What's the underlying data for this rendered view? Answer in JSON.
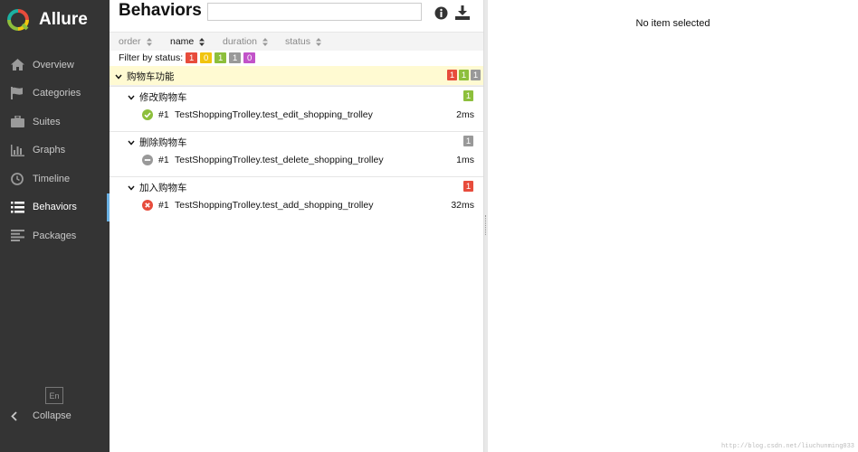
{
  "brand": {
    "name": "Allure"
  },
  "nav": [
    {
      "label": "Overview",
      "icon": "home-icon"
    },
    {
      "label": "Categories",
      "icon": "flag-icon"
    },
    {
      "label": "Suites",
      "icon": "briefcase-icon"
    },
    {
      "label": "Graphs",
      "icon": "bar-chart-icon"
    },
    {
      "label": "Timeline",
      "icon": "clock-icon"
    },
    {
      "label": "Behaviors",
      "icon": "list-icon",
      "active": true
    },
    {
      "label": "Packages",
      "icon": "align-left-icon"
    }
  ],
  "footer": {
    "lang": "En",
    "collapse": "Collapse"
  },
  "header": {
    "title": "Behaviors",
    "search_placeholder": ""
  },
  "sort": {
    "order": "order",
    "name": "name",
    "duration": "duration",
    "status": "status",
    "active": "name"
  },
  "filter": {
    "label": "Filter by status:",
    "chips": [
      {
        "value": "1",
        "color": "#e74c3c"
      },
      {
        "value": "0",
        "color": "#f1c40f"
      },
      {
        "value": "1",
        "color": "#8dbf3c"
      },
      {
        "value": "1",
        "color": "#999999"
      },
      {
        "value": "0",
        "color": "#c253c9"
      }
    ]
  },
  "tree": {
    "feature": {
      "name": "购物车功能",
      "badges": [
        "1",
        "1",
        "1"
      ]
    },
    "stories": [
      {
        "name": "修改购物车",
        "badge": "1",
        "badge_color": "#8dbf3c",
        "case": {
          "status": "passed",
          "number": "#1",
          "name": "TestShoppingTrolley.test_edit_shopping_trolley",
          "duration": "2ms"
        }
      },
      {
        "name": "删除购物车",
        "badge": "1",
        "badge_color": "#999999",
        "case": {
          "status": "skipped",
          "number": "#1",
          "name": "TestShoppingTrolley.test_delete_shopping_trolley",
          "duration": "1ms"
        }
      },
      {
        "name": "加入购物车",
        "badge": "1",
        "badge_color": "#e74c3c",
        "case": {
          "status": "failed",
          "number": "#1",
          "name": "TestShoppingTrolley.test_add_shopping_trolley",
          "duration": "32ms"
        }
      }
    ]
  },
  "detail": {
    "empty": "No item selected"
  },
  "watermark": "http://blog.csdn.net/liuchunming033"
}
